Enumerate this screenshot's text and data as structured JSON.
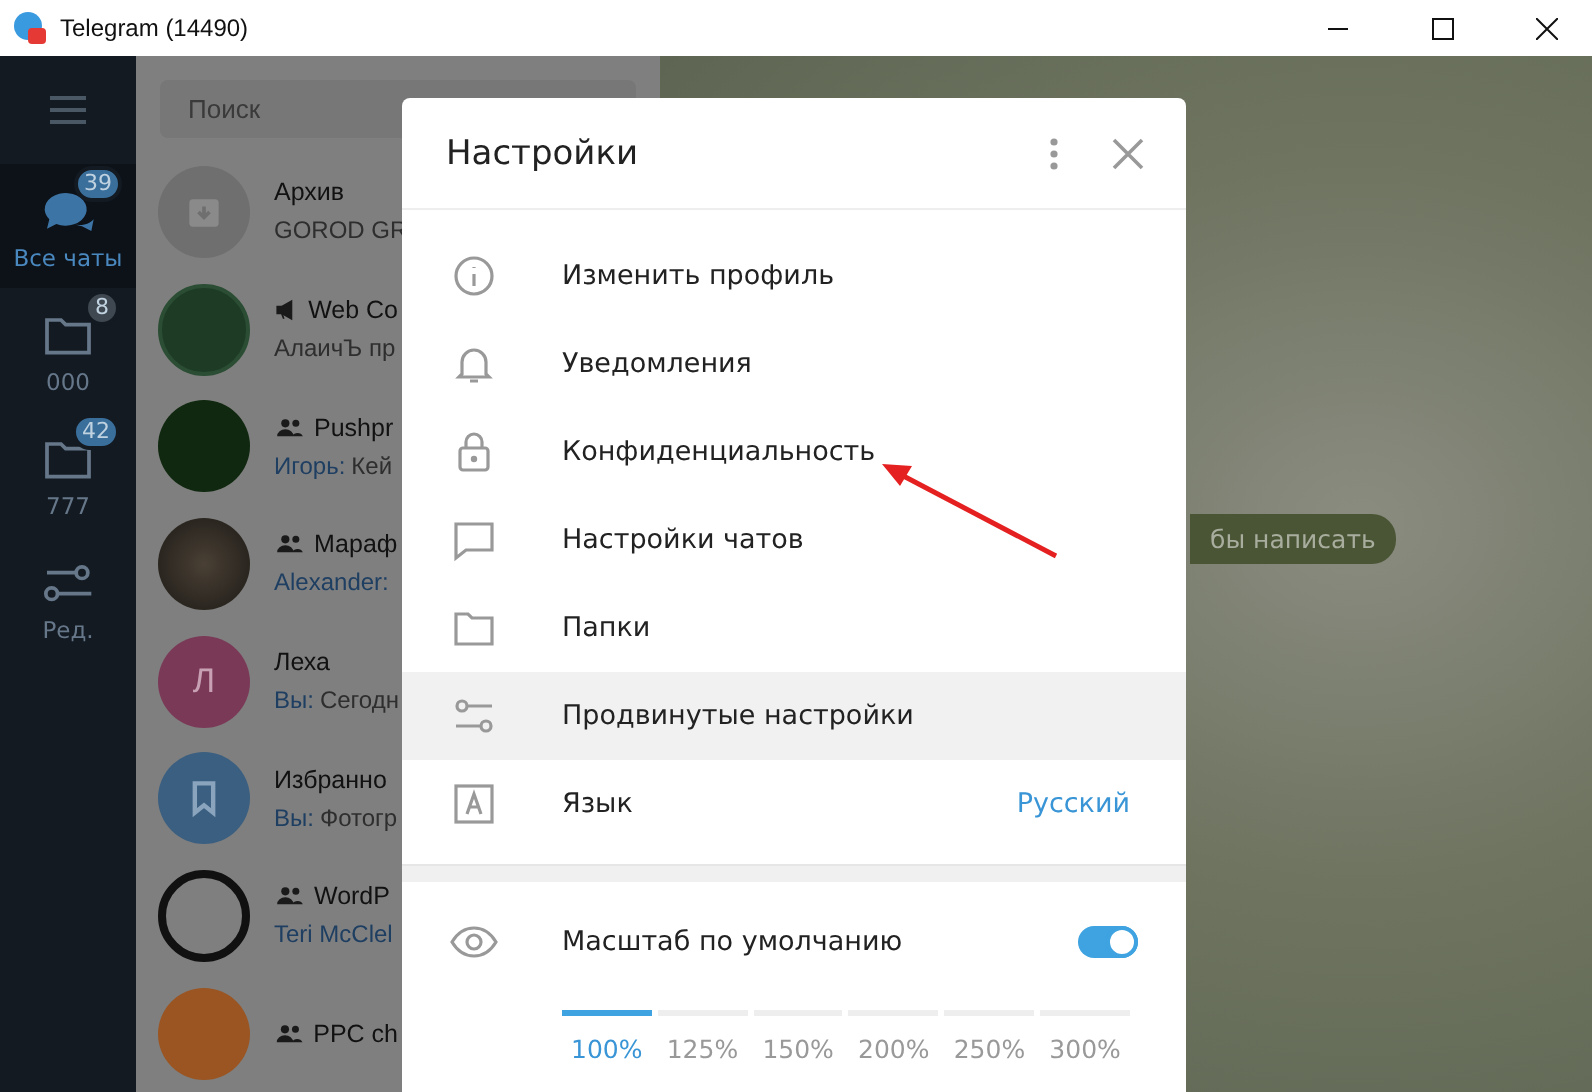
{
  "window": {
    "title": "Telegram (14490)"
  },
  "sidebar": {
    "folders": [
      {
        "label": "Все чаты",
        "badge": "39",
        "selected": true,
        "muted": false
      },
      {
        "label": "000",
        "badge": "8",
        "selected": false,
        "muted": true
      },
      {
        "label": "777",
        "badge": "42",
        "selected": false,
        "muted": false
      },
      {
        "label": "Ред.",
        "selected": false
      }
    ]
  },
  "chat_list": {
    "search": {
      "placeholder": "Поиск"
    },
    "chats": [
      {
        "name": "Архив",
        "preview": "GOROD GR",
        "group": false,
        "channel": false
      },
      {
        "name": "Web Co",
        "preview": "АлаичЪ пр",
        "group": false,
        "channel": true
      },
      {
        "name": "Pushpr",
        "preview": "Кей",
        "group": true,
        "channel": false,
        "sender": "Игорь:"
      },
      {
        "name": "Мараф",
        "group": true,
        "channel": false,
        "sender": "Alexander:"
      },
      {
        "name": "Леха",
        "preview": "Сегодн",
        "letter": "Л",
        "group": false,
        "channel": false,
        "sender": "Вы:"
      },
      {
        "name": "Избранно",
        "preview": "Фотогр",
        "group": false,
        "channel": false,
        "sender": "Вы:"
      },
      {
        "name": "WordP",
        "group": true,
        "channel": false,
        "sender": "Teri McClel"
      },
      {
        "name": "PPC ch",
        "group": true,
        "channel": false
      }
    ]
  },
  "background": {
    "hint": "бы написать"
  },
  "settings_dialog": {
    "title": "Настройки",
    "items": [
      {
        "label": "Изменить профиль",
        "highlighted": false
      },
      {
        "label": "Уведомления",
        "highlighted": false
      },
      {
        "label": "Конфиденциальность",
        "highlighted": false
      },
      {
        "label": "Настройки чатов",
        "highlighted": false
      },
      {
        "label": "Папки",
        "highlighted": false
      },
      {
        "label": "Продвинутые настройки",
        "highlighted": true
      },
      {
        "label": "Язык",
        "highlighted": false,
        "value": "Русский"
      }
    ],
    "scale": {
      "label": "Масштаб по умолчанию",
      "on": true,
      "options": [
        {
          "label": "100%",
          "selected": true
        },
        {
          "label": "125%",
          "selected": false
        },
        {
          "label": "150%",
          "selected": false
        },
        {
          "label": "200%",
          "selected": false
        },
        {
          "label": "250%",
          "selected": false
        },
        {
          "label": "300%",
          "selected": false
        }
      ]
    }
  }
}
